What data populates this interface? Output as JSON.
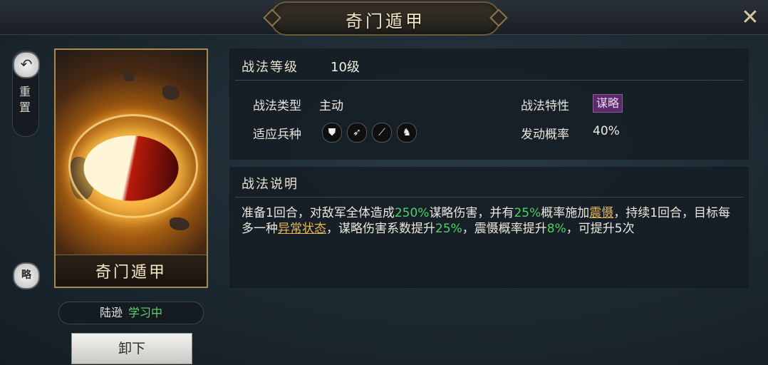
{
  "header": {
    "title": "奇门遁甲",
    "close_icon": "close-icon"
  },
  "side": {
    "reset_label": "重置",
    "reset_icon": "undo-icon",
    "strategy_label": "略"
  },
  "card": {
    "name": "奇门遁甲"
  },
  "learner": {
    "name": "陆逊",
    "status": "学习中"
  },
  "actions": {
    "unequip_label": "卸下"
  },
  "info": {
    "level_label": "战法等级",
    "level_value": "10级",
    "type_label": "战法类型",
    "type_value": "主动",
    "troop_label": "适应兵种",
    "troop_icons": [
      "shield-icon",
      "bow-icon",
      "spear-icon",
      "horse-icon"
    ],
    "trait_label": "战法特性",
    "trait_value": "谋略",
    "chance_label": "发动概率",
    "chance_value": "40%"
  },
  "description": {
    "title": "战法说明",
    "p1": "准备1回合，对敌军全体造成",
    "v1": "250%",
    "p2": "谋略伤害，并有",
    "v2": "25%",
    "p3": "概率施加",
    "link1": "震慑",
    "p4": "，持续1回合，目标每多一种",
    "link2": "异常状态",
    "p5": "，谋略伤害系数提升",
    "v3": "25%",
    "p6": "，震慑概率提升",
    "v4": "8%",
    "p7": "，可提升5次"
  },
  "colors": {
    "highlight_green": "#54cf67",
    "link_gold": "#e7b654",
    "trait_purple": "#5b2a6a"
  }
}
